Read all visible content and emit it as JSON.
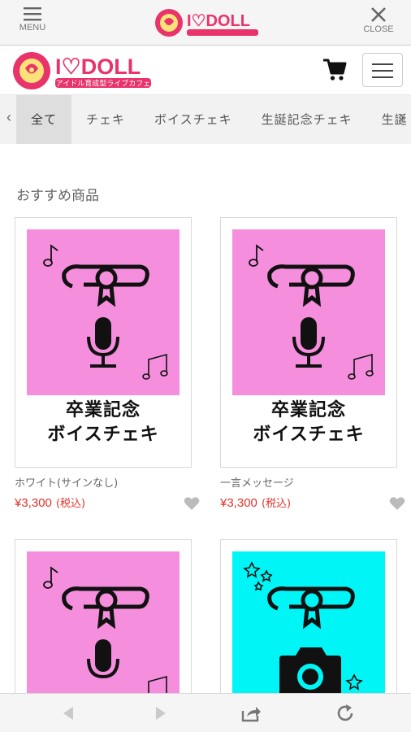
{
  "topbar": {
    "menu_label": "MENU",
    "close_label": "CLOSE"
  },
  "brand": {
    "logo_text": "I♡DOLL",
    "tagline": "アイドル育成型ライブカフェ",
    "accent": "#e8336b",
    "logo_yellow": "#fde27a"
  },
  "categories": {
    "tabs": [
      "全て",
      "チェキ",
      "ボイスチェキ",
      "生誕記念チェキ",
      "生誕"
    ],
    "active_index": 0
  },
  "section": {
    "title": "おすすめ商品"
  },
  "products": [
    {
      "caption_line1": "卒業記念",
      "caption_line2": "ボイスチェキ",
      "name": "ホワイト(サインなし)",
      "price": "¥3,300",
      "tax": "(税込)",
      "bg": "#f58fdd",
      "icon": "microphone-icon"
    },
    {
      "caption_line1": "卒業記念",
      "caption_line2": "ボイスチェキ",
      "name": "一言メッセージ",
      "price": "¥3,300",
      "tax": "(税込)",
      "bg": "#f58fdd",
      "icon": "microphone-icon"
    },
    {
      "caption_line1": "",
      "caption_line2": "",
      "name": "",
      "price": "",
      "tax": "",
      "bg": "#f58fdd",
      "icon": "microphone-icon"
    },
    {
      "caption_line1": "",
      "caption_line2": "",
      "name": "",
      "price": "",
      "tax": "",
      "bg": "#00f6f6",
      "icon": "camera-icon"
    }
  ],
  "colors": {
    "price": "#e0342c",
    "pink_art": "#f58fdd",
    "cyan_art": "#00f6f6"
  }
}
